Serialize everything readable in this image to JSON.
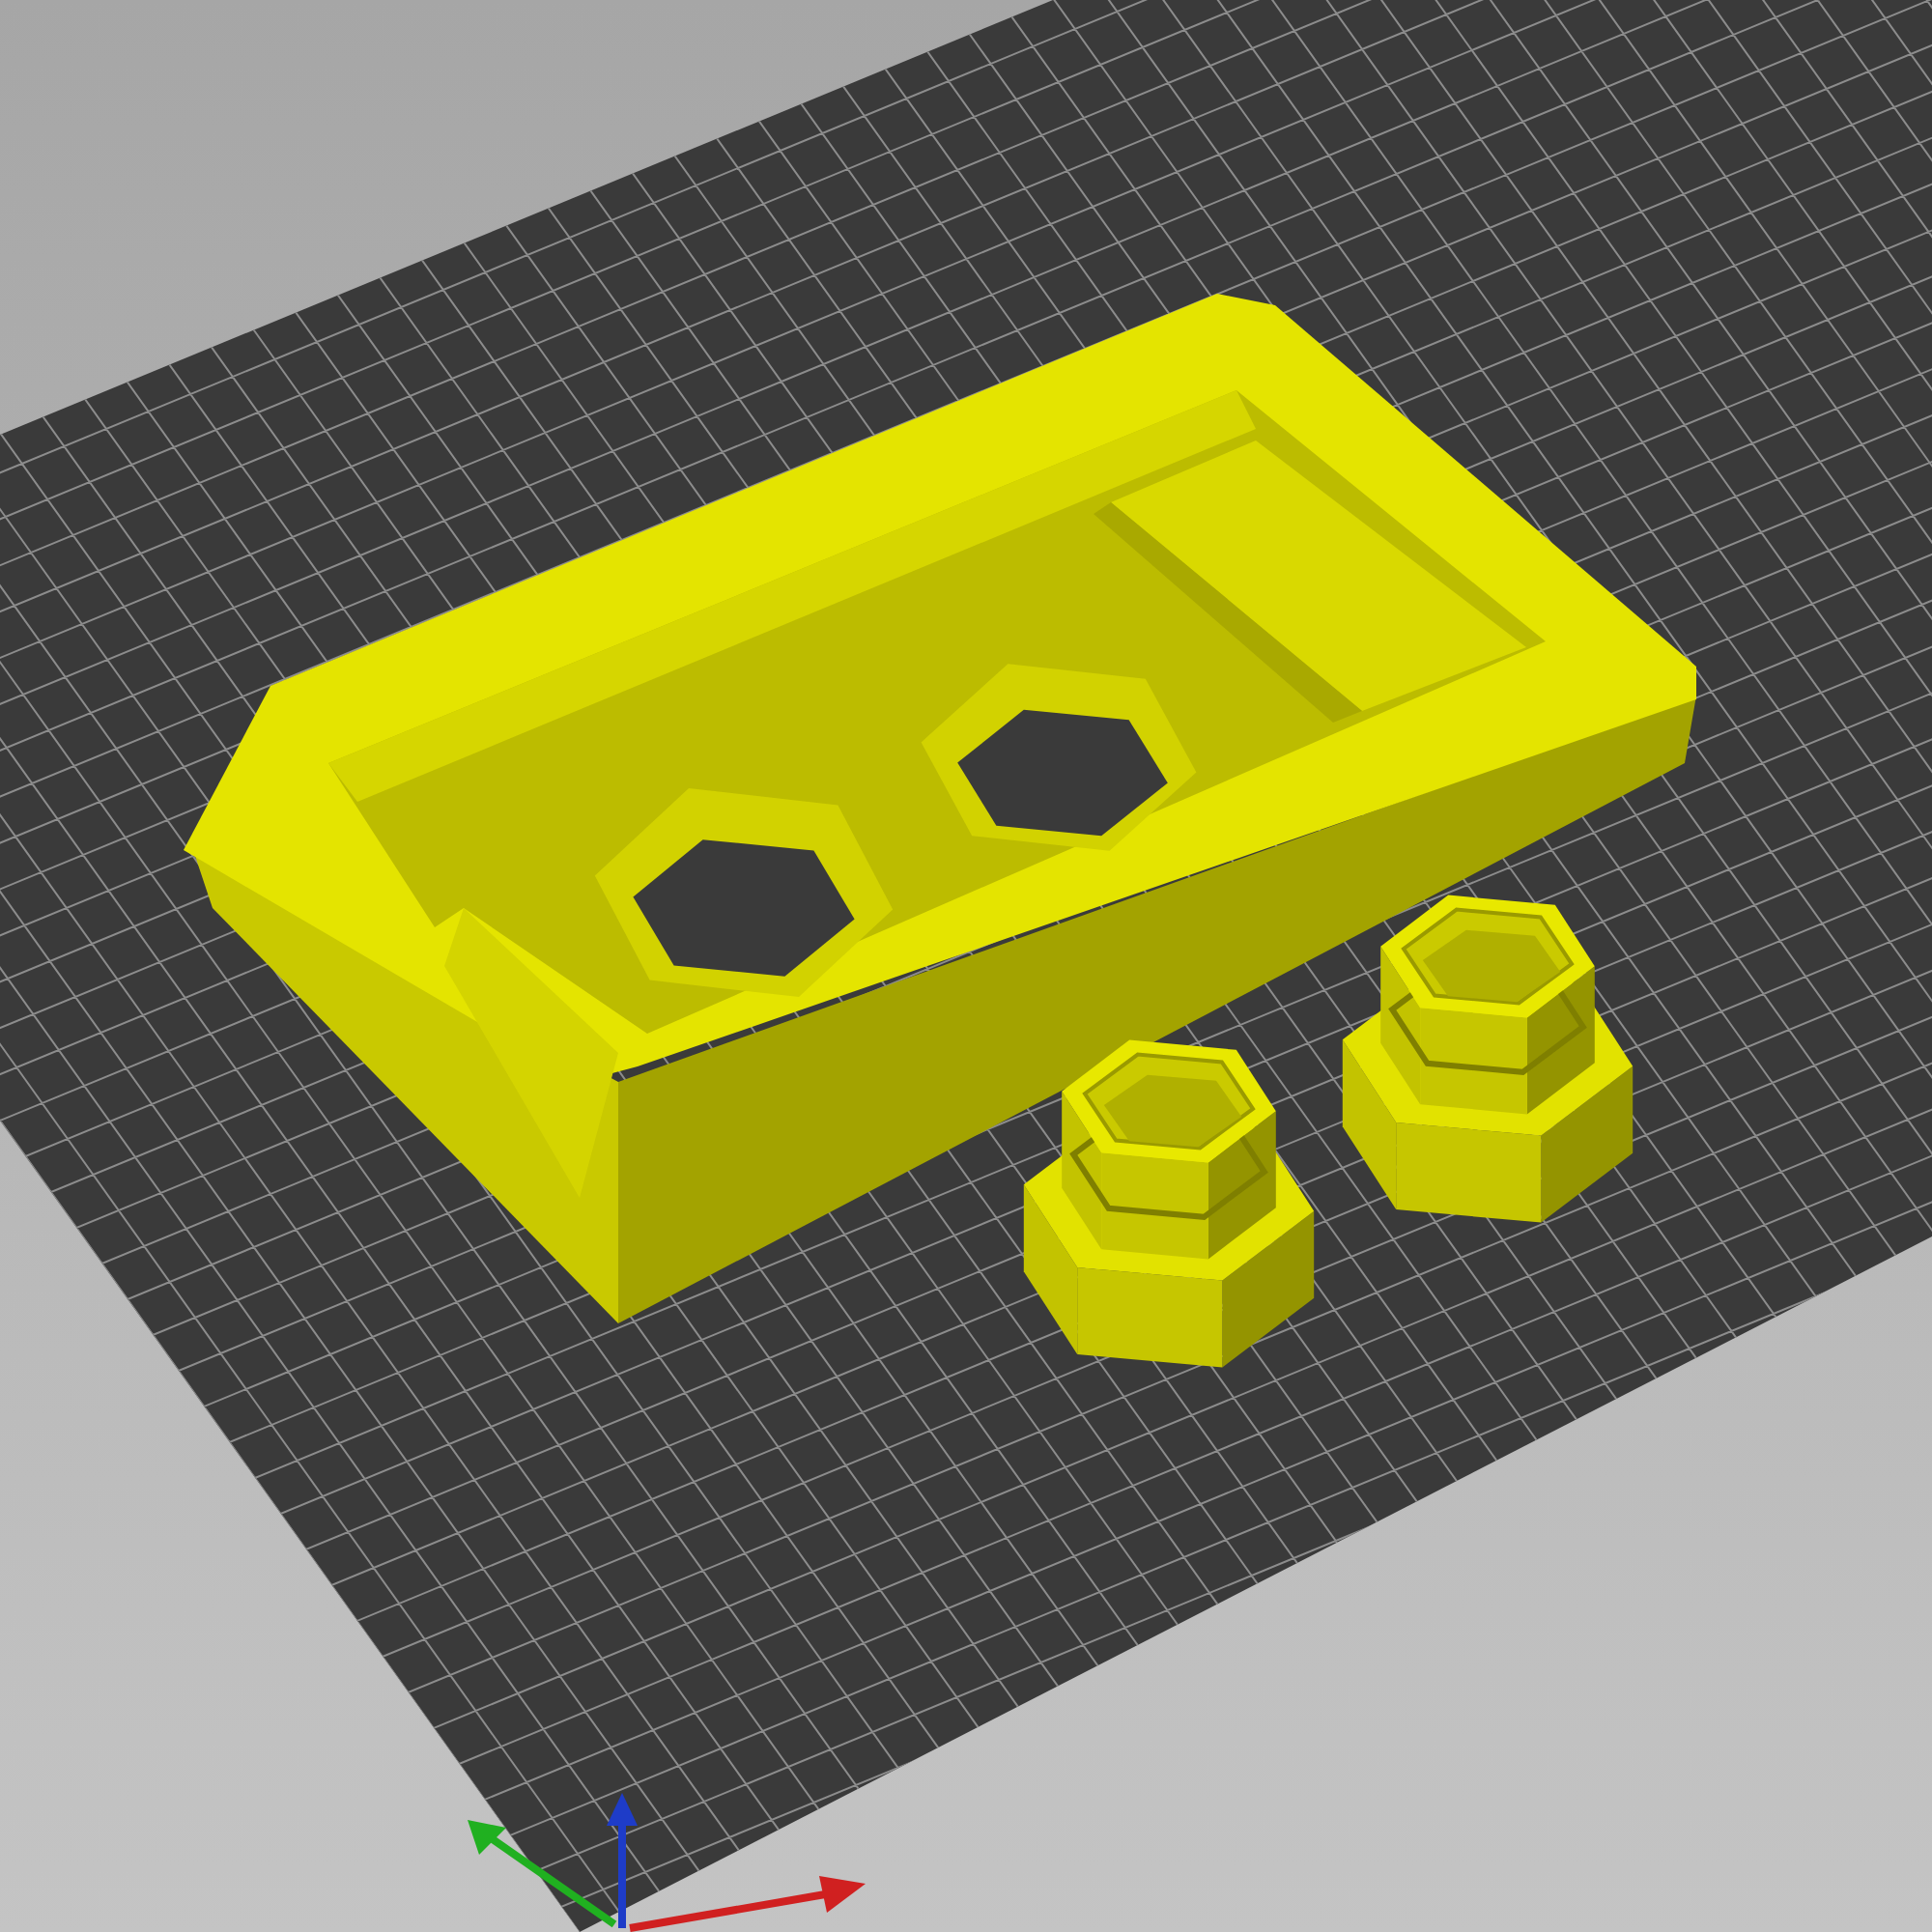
{
  "scene": {
    "objects": [
      {
        "kind": "tray"
      },
      {
        "kind": "hex-cap"
      },
      {
        "kind": "hex-cap"
      }
    ]
  }
}
